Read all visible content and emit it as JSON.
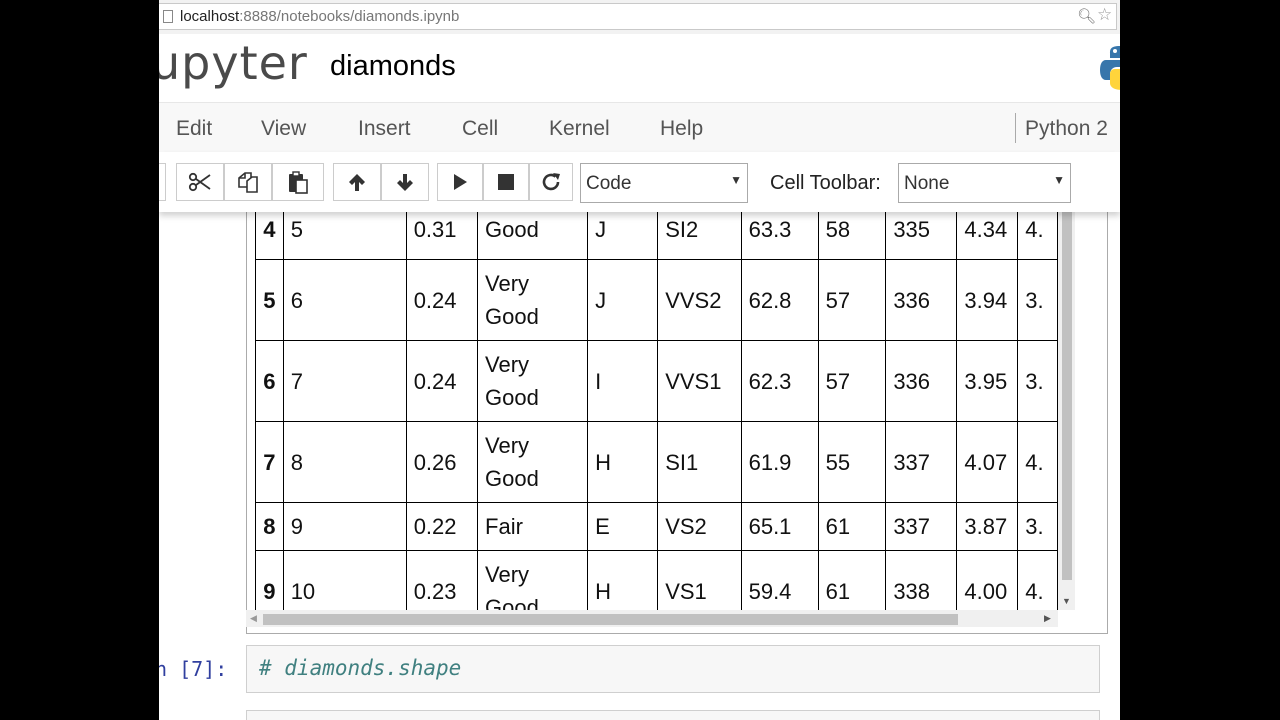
{
  "browser": {
    "url_host": "localhost",
    "url_rest": ":8888/notebooks/diamonds.ipynb"
  },
  "header": {
    "logo_text": "upyter",
    "notebook_title": "diamonds"
  },
  "menu": {
    "items": [
      "Edit",
      "View",
      "Insert",
      "Cell",
      "Kernel",
      "Help"
    ],
    "kernel": "Python 2"
  },
  "toolbar": {
    "cell_type": "Code",
    "cell_toolbar_label": "Cell Toolbar:",
    "cell_toolbar_value": "None"
  },
  "table": {
    "rows": [
      {
        "index": "4",
        "cells": [
          "5",
          "0.31",
          "Good",
          "J",
          "SI2",
          "63.3",
          "58",
          "335",
          "4.34",
          "4."
        ]
      },
      {
        "index": "5",
        "cells": [
          "6",
          "0.24",
          "Very\nGood",
          "J",
          "VVS2",
          "62.8",
          "57",
          "336",
          "3.94",
          "3."
        ]
      },
      {
        "index": "6",
        "cells": [
          "7",
          "0.24",
          "Very\nGood",
          "I",
          "VVS1",
          "62.3",
          "57",
          "336",
          "3.95",
          "3."
        ]
      },
      {
        "index": "7",
        "cells": [
          "8",
          "0.26",
          "Very\nGood",
          "H",
          "SI1",
          "61.9",
          "55",
          "337",
          "4.07",
          "4."
        ]
      },
      {
        "index": "8",
        "cells": [
          "9",
          "0.22",
          "Fair",
          "E",
          "VS2",
          "65.1",
          "61",
          "337",
          "3.87",
          "3."
        ]
      },
      {
        "index": "9",
        "cells": [
          "10",
          "0.23",
          "Very\nGood",
          "H",
          "VS1",
          "59.4",
          "61",
          "338",
          "4.00",
          "4."
        ]
      }
    ]
  },
  "code_cell": {
    "prompt": "n [7]:",
    "code": "# diamonds.shape"
  }
}
